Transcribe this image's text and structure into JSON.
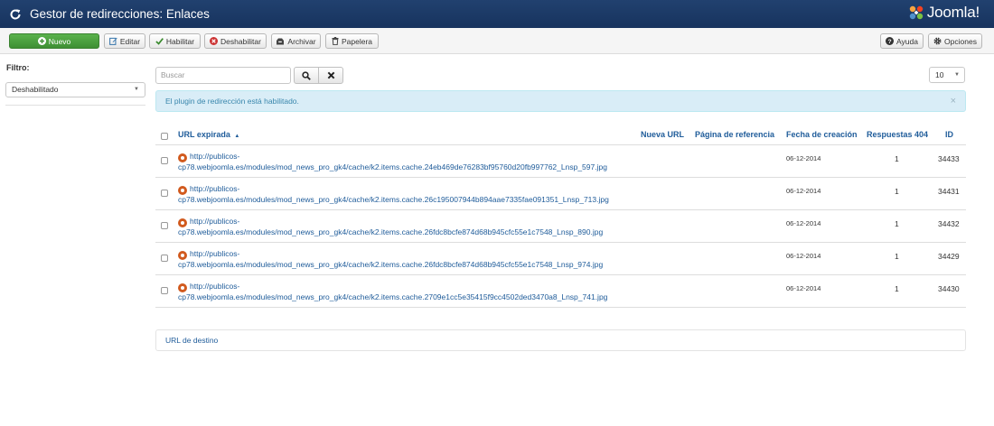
{
  "header": {
    "title": "Gestor de redirecciones: Enlaces",
    "logo_text": "Joomla!"
  },
  "toolbar": {
    "new_label": "Nuevo",
    "edit_label": "Editar",
    "enable_label": "Habilitar",
    "disable_label": "Deshabilitar",
    "archive_label": "Archivar",
    "trash_label": "Papelera",
    "help_label": "Ayuda",
    "options_label": "Opciones"
  },
  "sidebar": {
    "filter_label": "Filtro:",
    "filter_value": "Deshabilitado"
  },
  "search": {
    "placeholder": "Buscar",
    "limit": "10"
  },
  "alert": {
    "message": "El plugin de redirección está habilitado.",
    "close": "×"
  },
  "table": {
    "headers": {
      "expired_url": "URL expirada",
      "new_url": "Nueva URL",
      "referer": "Página de referencia",
      "created": "Fecha de creación",
      "hits": "Respuestas 404",
      "id": "ID"
    },
    "rows": [
      {
        "url_line1": "http://publicos-",
        "url_line2": "cp78.webjoomla.es/modules/mod_news_pro_gk4/cache/k2.items.cache.24eb469de76283bf95760d20fb997762_Lnsp_597.jpg",
        "date": "06-12-2014",
        "hits": "1",
        "id": "34433"
      },
      {
        "url_line1": "http://publicos-",
        "url_line2": "cp78.webjoomla.es/modules/mod_news_pro_gk4/cache/k2.items.cache.26c195007944b894aae7335fae091351_Lnsp_713.jpg",
        "date": "06-12-2014",
        "hits": "1",
        "id": "34431"
      },
      {
        "url_line1": "http://publicos-",
        "url_line2": "cp78.webjoomla.es/modules/mod_news_pro_gk4/cache/k2.items.cache.26fdc8bcfe874d68b945cfc55e1c7548_Lnsp_890.jpg",
        "date": "06-12-2014",
        "hits": "1",
        "id": "34432"
      },
      {
        "url_line1": "http://publicos-",
        "url_line2": "cp78.webjoomla.es/modules/mod_news_pro_gk4/cache/k2.items.cache.26fdc8bcfe874d68b945cfc55e1c7548_Lnsp_974.jpg",
        "date": "06-12-2014",
        "hits": "1",
        "id": "34429"
      },
      {
        "url_line1": "http://publicos-",
        "url_line2": "cp78.webjoomla.es/modules/mod_news_pro_gk4/cache/k2.items.cache.2709e1cc5e35415f9cc4502ded3470a8_Lnsp_741.jpg",
        "date": "06-12-2014",
        "hits": "1",
        "id": "34430"
      }
    ]
  },
  "destination": {
    "label": "URL de destino"
  },
  "colors": {
    "header": "#1a3867",
    "new_button": "#4ea243",
    "link": "#1f5c9a",
    "alert_bg": "#d9edf7",
    "alert_text": "#3a87ad",
    "warning": "#d15a1e"
  }
}
